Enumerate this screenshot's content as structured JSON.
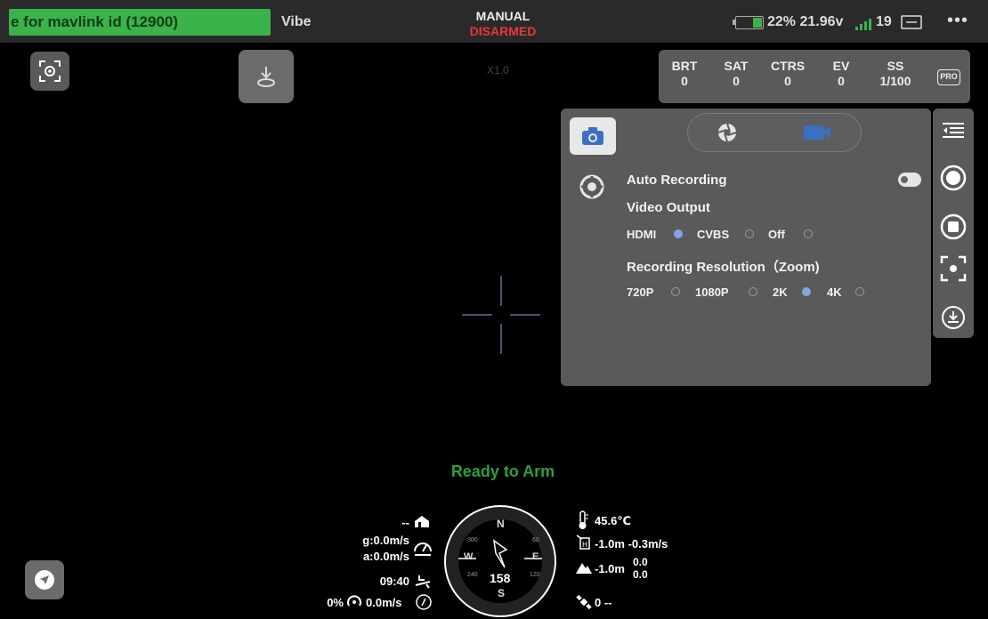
{
  "topbar": {
    "status_message": "e for mavlink id (12900)",
    "vehicle_name": "Vibe",
    "flight_mode": "MANUAL",
    "arm_state": "DISARMED",
    "battery": "22% 21.96v",
    "satellites": "19",
    "more": "•••"
  },
  "zoom": "X1.0",
  "camera_settings": [
    {
      "label": "BRT",
      "value": "0"
    },
    {
      "label": "SAT",
      "value": "0"
    },
    {
      "label": "CTRS",
      "value": "0"
    },
    {
      "label": "EV",
      "value": "0"
    },
    {
      "label": "SS",
      "value": "1/100"
    }
  ],
  "pro_badge": "PRO",
  "panel": {
    "auto_recording": "Auto Recording",
    "auto_recording_on": false,
    "video_output": "Video Output",
    "video_output_options": [
      "HDMI",
      "CVBS",
      "Off"
    ],
    "video_output_selected": "HDMI",
    "resolution_label": "Recording Resolution（Zoom)",
    "resolution_options": [
      "720P",
      "1080P",
      "2K",
      "4K"
    ],
    "resolution_selected": "2K"
  },
  "hud": {
    "status": "Ready to Arm",
    "home_dist": "--",
    "ground_speed": "g:0.0m/s",
    "air_speed": "a:0.0m/s",
    "flight_time": "09:40",
    "throttle_wind": "0% ",
    "wind_speed": "0.0m/s",
    "temperature": "45.6℃",
    "rel_alt": "-1.0m -0.3m/s",
    "terrain_alt": "-1.0m",
    "terrain_a": "0.0",
    "terrain_b": "0.0",
    "gps": "0 --",
    "heading": "158",
    "compass": {
      "N": "N",
      "S": "S",
      "E": "E",
      "W": "W",
      "t300": "300",
      "t60": "60",
      "t120": "120",
      "t240": "240"
    }
  },
  "colors": {
    "ready": "#2e9e3e",
    "disarmed": "#e53935",
    "status_bg": "#3bb34a",
    "accent": "#7fa7e0"
  }
}
